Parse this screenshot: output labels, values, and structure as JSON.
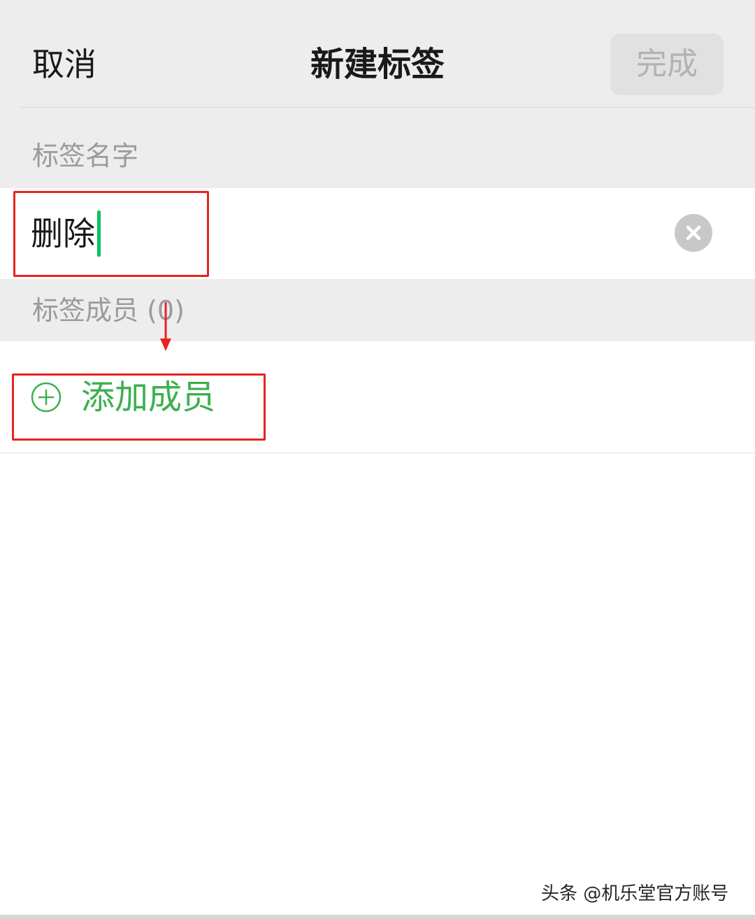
{
  "nav": {
    "cancel_label": "取消",
    "title": "新建标签",
    "done_label": "完成"
  },
  "tag_name": {
    "section_label": "标签名字",
    "input_value": "删除",
    "clear_icon": "clear-icon"
  },
  "members": {
    "section_label": "标签成员 (0)",
    "add_label": "添加成员",
    "add_icon": "plus-circle-icon"
  },
  "watermark": {
    "text": "头条 @机乐堂官方账号"
  },
  "colors": {
    "accent_green": "#07c160",
    "add_text_green": "#3bb04f",
    "annotation_red": "#e8231f",
    "header_bg": "#ededed"
  }
}
